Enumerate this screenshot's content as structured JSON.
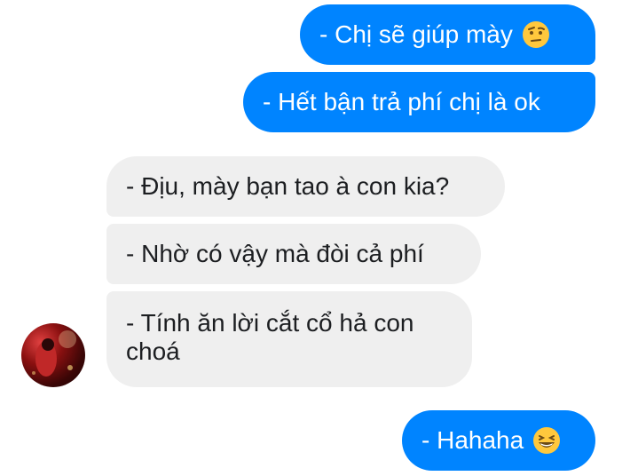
{
  "messages": [
    {
      "text": "- Chị sẽ giúp mày",
      "emoji": "raised-eyebrow-emoji"
    },
    {
      "text": "- Hết bận trả phí chị là ok"
    },
    {
      "text": "- Địu, mày bạn tao à con kia?"
    },
    {
      "text": "- Nhờ có vậy mà đòi cả phí"
    },
    {
      "text": "- Tính ăn lời cắt cổ hả con choá"
    },
    {
      "text": "- Hahaha",
      "emoji": "grinning-squinting-emoji"
    }
  ],
  "colors": {
    "outgoing_bubble": "#0084ff",
    "incoming_bubble": "#efefef",
    "outgoing_text": "#ffffff",
    "incoming_text": "#1c1e21"
  }
}
